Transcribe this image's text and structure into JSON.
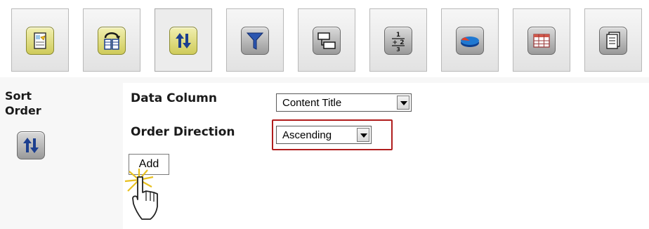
{
  "toolbar": {
    "buttons": [
      {
        "name": "properties",
        "icon": "edit-page-icon",
        "active": false
      },
      {
        "name": "columns",
        "icon": "columns-swap-icon",
        "active": false
      },
      {
        "name": "sort",
        "icon": "sort-arrows-icon",
        "active": true
      },
      {
        "name": "filter",
        "icon": "funnel-filter-icon",
        "active": false
      },
      {
        "name": "grouping",
        "icon": "group-boxes-icon",
        "active": false
      },
      {
        "name": "calculations",
        "icon": "fraction-icon",
        "active": false
      },
      {
        "name": "chart",
        "icon": "pie-chart-icon",
        "active": false
      },
      {
        "name": "table",
        "icon": "table-grid-icon",
        "active": false
      },
      {
        "name": "document",
        "icon": "document-icon",
        "active": false
      }
    ]
  },
  "panel": {
    "title": "Sort Order",
    "icon": "sort-arrows-icon"
  },
  "form": {
    "data_column_label": "Data Column",
    "data_column_value": "Content Title",
    "order_direction_label": "Order Direction",
    "order_direction_value": "Ascending",
    "add_label": "Add"
  },
  "colors": {
    "highlight": "#b01d1d",
    "active_tile": "#cfcb5a",
    "arrow_blue": "#1c3f8f"
  }
}
